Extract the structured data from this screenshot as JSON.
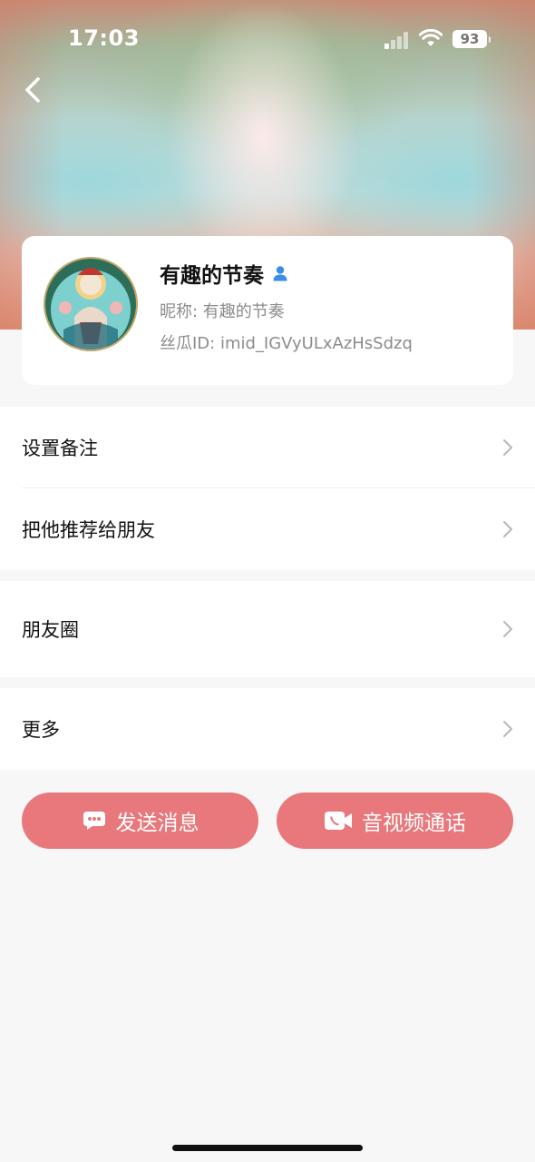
{
  "status_bar": {
    "time": "17:03",
    "battery": "93"
  },
  "nav": {
    "back_icon": "chevron-left-icon"
  },
  "profile": {
    "name": "有趣的节奏",
    "badge_icon": "person-icon",
    "nickname": "昵称: 有趣的节奏",
    "id": "丝瓜ID: imid_IGVyULxAzHsSdzq"
  },
  "menu": {
    "set_remark": "设置备注",
    "recommend": "把他推荐给朋友",
    "moments": "朋友圈",
    "more": "更多"
  },
  "actions": {
    "send_message": "发送消息",
    "video_call": "音视频通话"
  },
  "colors": {
    "accent": "#e8787c",
    "verified_badge": "#3a8ee6",
    "page_background": "#f7f7f7"
  }
}
